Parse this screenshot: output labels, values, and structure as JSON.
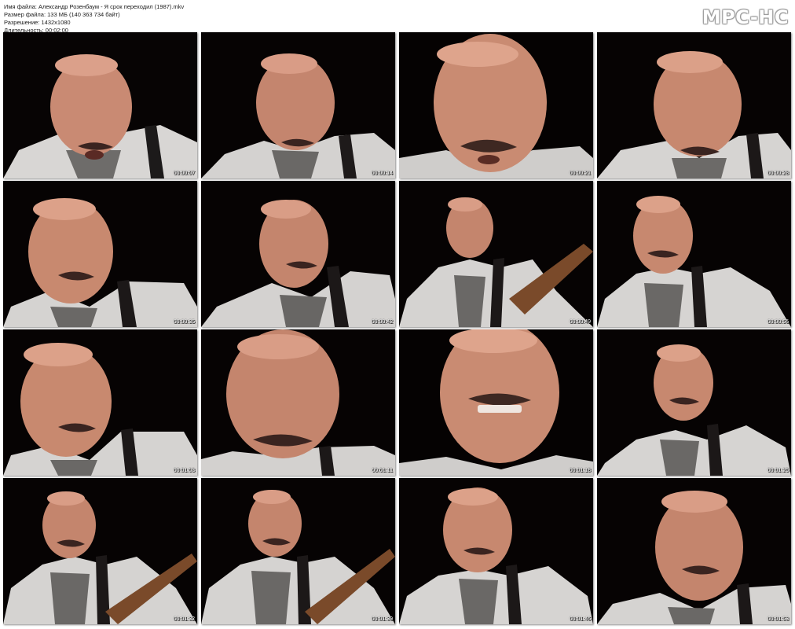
{
  "info": {
    "file_name": "Имя файла: Александр Розенбаум - Я срок переходил (1987).mkv",
    "file_size": "Размер файла: 133 МБ (140 363 734 байт)",
    "resolution": "Разрешение: 1432x1080",
    "duration": "Длительность: 00:02:00"
  },
  "logo": "MPC-HC",
  "thumbnails": [
    {
      "timestamp": "00:00:07"
    },
    {
      "timestamp": "00:00:14"
    },
    {
      "timestamp": "00:00:21"
    },
    {
      "timestamp": "00:00:28"
    },
    {
      "timestamp": "00:00:35"
    },
    {
      "timestamp": "00:00:42"
    },
    {
      "timestamp": "00:00:49"
    },
    {
      "timestamp": "00:00:56"
    },
    {
      "timestamp": "00:01:03"
    },
    {
      "timestamp": "00:01:11"
    },
    {
      "timestamp": "00:01:18"
    },
    {
      "timestamp": "00:01:25"
    },
    {
      "timestamp": "00:01:32"
    },
    {
      "timestamp": "00:01:39"
    },
    {
      "timestamp": "00:01:46"
    },
    {
      "timestamp": "00:01:53"
    }
  ]
}
